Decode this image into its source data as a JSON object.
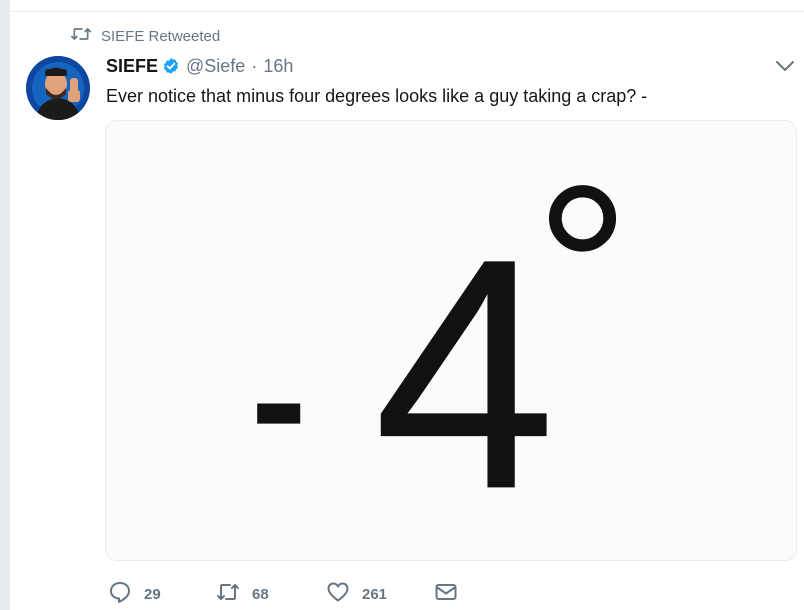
{
  "retweet_context": {
    "text": "SIEFE Retweeted"
  },
  "tweet": {
    "display_name": "SIEFE",
    "handle": "@Siefe",
    "separator": "·",
    "time": "16h",
    "text": "Ever notice that minus four degrees looks like a guy taking a crap? -",
    "media": {
      "minus": "-",
      "digit": "4",
      "degree": "°"
    }
  },
  "actions": {
    "reply_count": "29",
    "retweet_count": "68",
    "like_count": "261"
  },
  "colors": {
    "muted": "#657786",
    "text": "#14171a",
    "border": "#e6ecf0",
    "verified": "#1da1f2"
  },
  "icons": {
    "retweet": "retweet-icon",
    "verified": "verified-badge-icon",
    "caret": "chevron-down-icon",
    "reply": "reply-icon",
    "like": "heart-icon",
    "dm": "envelope-icon"
  }
}
